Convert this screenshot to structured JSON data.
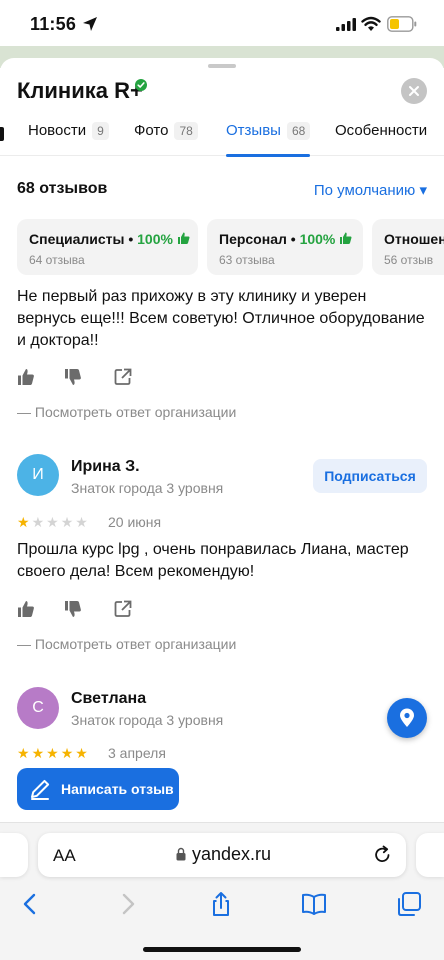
{
  "status_bar": {
    "time": "11:56"
  },
  "clinic": {
    "title": "Клиника R+"
  },
  "tabs": [
    {
      "label": "Новости",
      "count": "9"
    },
    {
      "label": "Фото",
      "count": "78"
    },
    {
      "label": "Отзывы",
      "count": "68"
    },
    {
      "label": "Особенности"
    }
  ],
  "reviews_header": {
    "count_label": "68 отзывов",
    "sort_label": "По умолчанию ▾"
  },
  "categories": [
    {
      "name": "Специалисты",
      "percent": "100%",
      "sub": "64 отзыва"
    },
    {
      "name": "Персонал",
      "percent": "100%",
      "sub": "63 отзыва"
    },
    {
      "name": "Отношен",
      "sub": "56 отзыв"
    }
  ],
  "reviews": [
    {
      "text": "Не первый раз прихожу в эту клинику и уверен вернусь еще!!! Всем советую! Отличное оборудование и доктора!!",
      "org_reply": "— Посмотреть ответ организации"
    },
    {
      "avatar": "И",
      "author": "Ирина З.",
      "level": "Знаток города 3 уровня",
      "subscribe": "Подписаться",
      "rating": 1,
      "date": "20 июня",
      "text": "Прошла курс lpg , очень понравилась Лиана, мастер своего дела! Всем рекомендую!",
      "org_reply": "— Посмотреть ответ организации"
    },
    {
      "avatar": "С",
      "author": "Светлана",
      "level": "Знаток города 3 уровня",
      "rating": 5,
      "date": "3 апреля"
    }
  ],
  "write_review": "Написать отзыв",
  "browser": {
    "aa": "AA",
    "url": "yandex.ru"
  },
  "colors": {
    "accent": "#1a6fe0",
    "positive": "#24a340",
    "star": "#f6b300"
  }
}
